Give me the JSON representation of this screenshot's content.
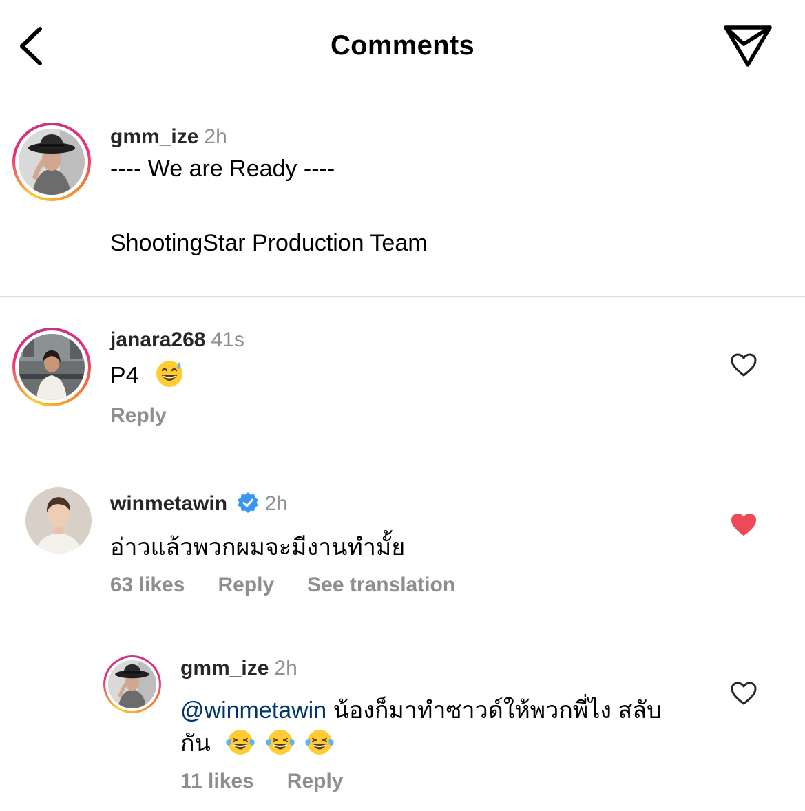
{
  "header": {
    "title": "Comments"
  },
  "caption": {
    "username": "gmm_ize",
    "time": "2h",
    "line1": "---- We are Ready ----",
    "line2": "ShootingStar Production Team"
  },
  "comments": [
    {
      "username": "janara268",
      "time": "41s",
      "text": "P4",
      "reply_label": "Reply",
      "liked": false
    },
    {
      "username": "winmetawin",
      "verified": true,
      "time": "2h",
      "text": "อ่าวแล้วพวกผมจะมีงานทำมั้ย",
      "likes_label": "63 likes",
      "reply_label": "Reply",
      "translate_label": "See translation",
      "liked": true,
      "replies": [
        {
          "username": "gmm_ize",
          "time": "2h",
          "mention": "@winmetawin",
          "text_line1": " น้องก็มาทำซาวด์ให้พวกพี่ไง สลับ",
          "text_line2": "กัน",
          "likes_label": "11 likes",
          "reply_label": "Reply",
          "liked": false
        }
      ]
    }
  ],
  "colors": {
    "heart_liked": "#ed4956",
    "verified": "#3897f0",
    "mention": "#00376b",
    "meta": "#8e8e8e"
  }
}
